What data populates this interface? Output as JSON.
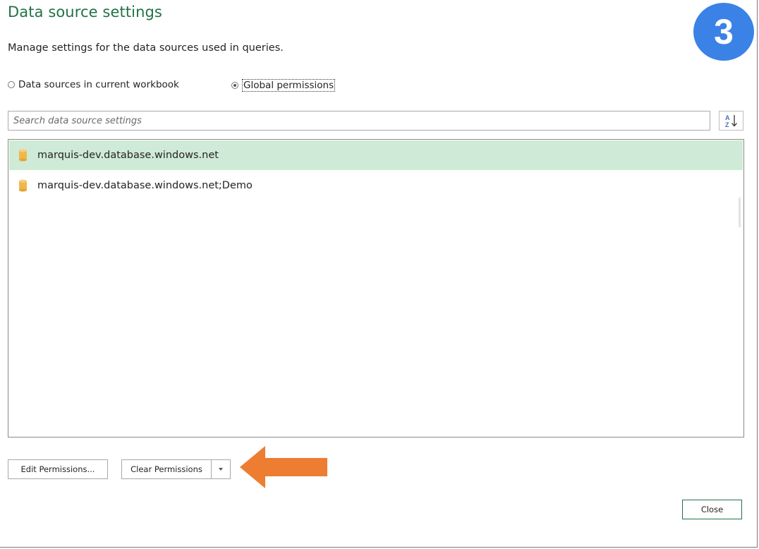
{
  "dialog": {
    "title": "Data source settings",
    "subtitle": "Manage settings for the data sources used in queries.",
    "step_badge": "3"
  },
  "scope": {
    "options": [
      {
        "label": "Data sources in current workbook",
        "selected": false
      },
      {
        "label": "Global permissions",
        "selected": true
      }
    ]
  },
  "search": {
    "placeholder": "Search data source settings",
    "value": "",
    "sort_icon": "sort-ascending-icon"
  },
  "data_sources": [
    {
      "name": "marquis-dev.database.windows.net",
      "icon": "database-icon",
      "selected": true
    },
    {
      "name": "marquis-dev.database.windows.net;Demo",
      "icon": "database-icon",
      "selected": false
    }
  ],
  "buttons": {
    "edit_permissions": "Edit Permissions...",
    "clear_permissions": "Clear Permissions",
    "clear_dropdown_icon": "chevron-down-icon",
    "close": "Close"
  },
  "annotation": {
    "arrow_icon": "arrow-left-icon",
    "arrow_color": "#ed7d31"
  },
  "colors": {
    "title": "#217346",
    "selected_row": "#cfead6",
    "badge": "#3b82e6",
    "db_icon": "#f0b84a"
  }
}
